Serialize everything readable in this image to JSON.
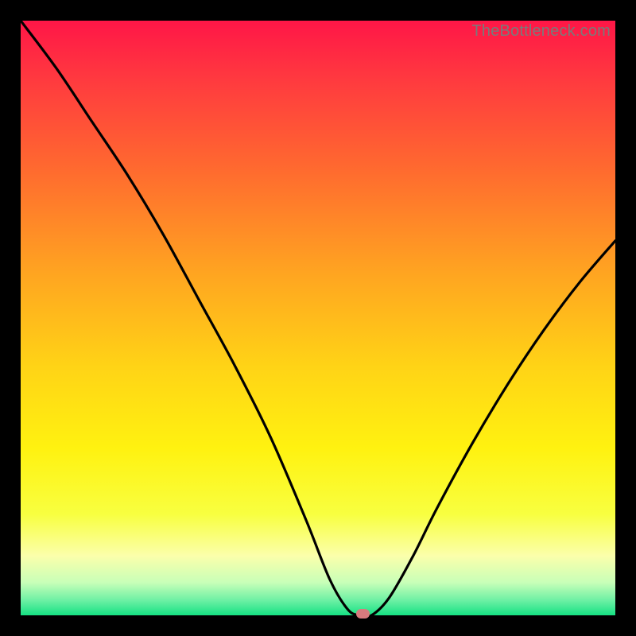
{
  "watermark": "TheBottleneck.com",
  "colors": {
    "gradient_stops": [
      {
        "offset": 0.0,
        "color": "#ff1647"
      },
      {
        "offset": 0.1,
        "color": "#ff3a3f"
      },
      {
        "offset": 0.25,
        "color": "#ff6a2f"
      },
      {
        "offset": 0.42,
        "color": "#ffa321"
      },
      {
        "offset": 0.58,
        "color": "#ffd316"
      },
      {
        "offset": 0.72,
        "color": "#fff210"
      },
      {
        "offset": 0.83,
        "color": "#f8ff40"
      },
      {
        "offset": 0.9,
        "color": "#fbffab"
      },
      {
        "offset": 0.945,
        "color": "#c8ffb8"
      },
      {
        "offset": 0.975,
        "color": "#6cf0a4"
      },
      {
        "offset": 1.0,
        "color": "#16e183"
      }
    ],
    "curve": "#000000",
    "marker": "#d87b7e",
    "frame": "#000000"
  },
  "chart_data": {
    "type": "line",
    "title": "",
    "xlabel": "",
    "ylabel": "",
    "xlim": [
      0,
      100
    ],
    "ylim": [
      0,
      100
    ],
    "grid": false,
    "series": [
      {
        "name": "bottleneck-curve",
        "x": [
          0,
          6,
          12,
          18,
          24,
          30,
          36,
          42,
          48,
          52,
          55,
          57,
          59,
          62,
          66,
          70,
          76,
          82,
          88,
          94,
          100
        ],
        "values": [
          100,
          92,
          83,
          74,
          64,
          53,
          42,
          30,
          16,
          6,
          1,
          0,
          0,
          3,
          10,
          18,
          29,
          39,
          48,
          56,
          63
        ]
      }
    ],
    "marker": {
      "x": 57.5,
      "y": 0
    }
  }
}
